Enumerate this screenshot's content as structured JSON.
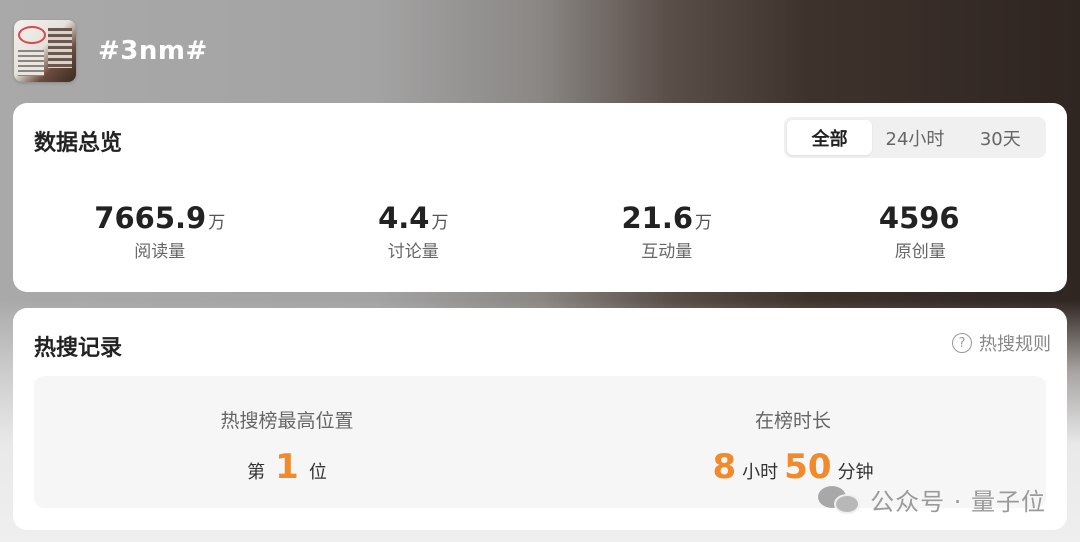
{
  "header": {
    "topic": "#3nm#",
    "thumbnail_icon": "topic-thumbnail"
  },
  "overview": {
    "title": "数据总览",
    "tabs": [
      {
        "label": "全部",
        "active": true
      },
      {
        "label": "24小时",
        "active": false
      },
      {
        "label": "30天",
        "active": false
      }
    ],
    "stats": [
      {
        "value": "7665.9",
        "unit": "万",
        "label": "阅读量"
      },
      {
        "value": "4.4",
        "unit": "万",
        "label": "讨论量"
      },
      {
        "value": "21.6",
        "unit": "万",
        "label": "互动量"
      },
      {
        "value": "4596",
        "unit": "",
        "label": "原创量"
      }
    ]
  },
  "hot": {
    "title": "热搜记录",
    "rules_label": "热搜规则",
    "highest": {
      "title": "热搜榜最高位置",
      "prefix": "第",
      "value": "1",
      "suffix": "位"
    },
    "duration": {
      "title": "在榜时长",
      "hours": "8",
      "hours_unit": "小时",
      "minutes": "50",
      "minutes_unit": "分钟"
    }
  },
  "watermark": {
    "text": "公众号 · 量子位"
  },
  "colors": {
    "accent": "#f08a2a",
    "card_bg": "#ffffff"
  }
}
